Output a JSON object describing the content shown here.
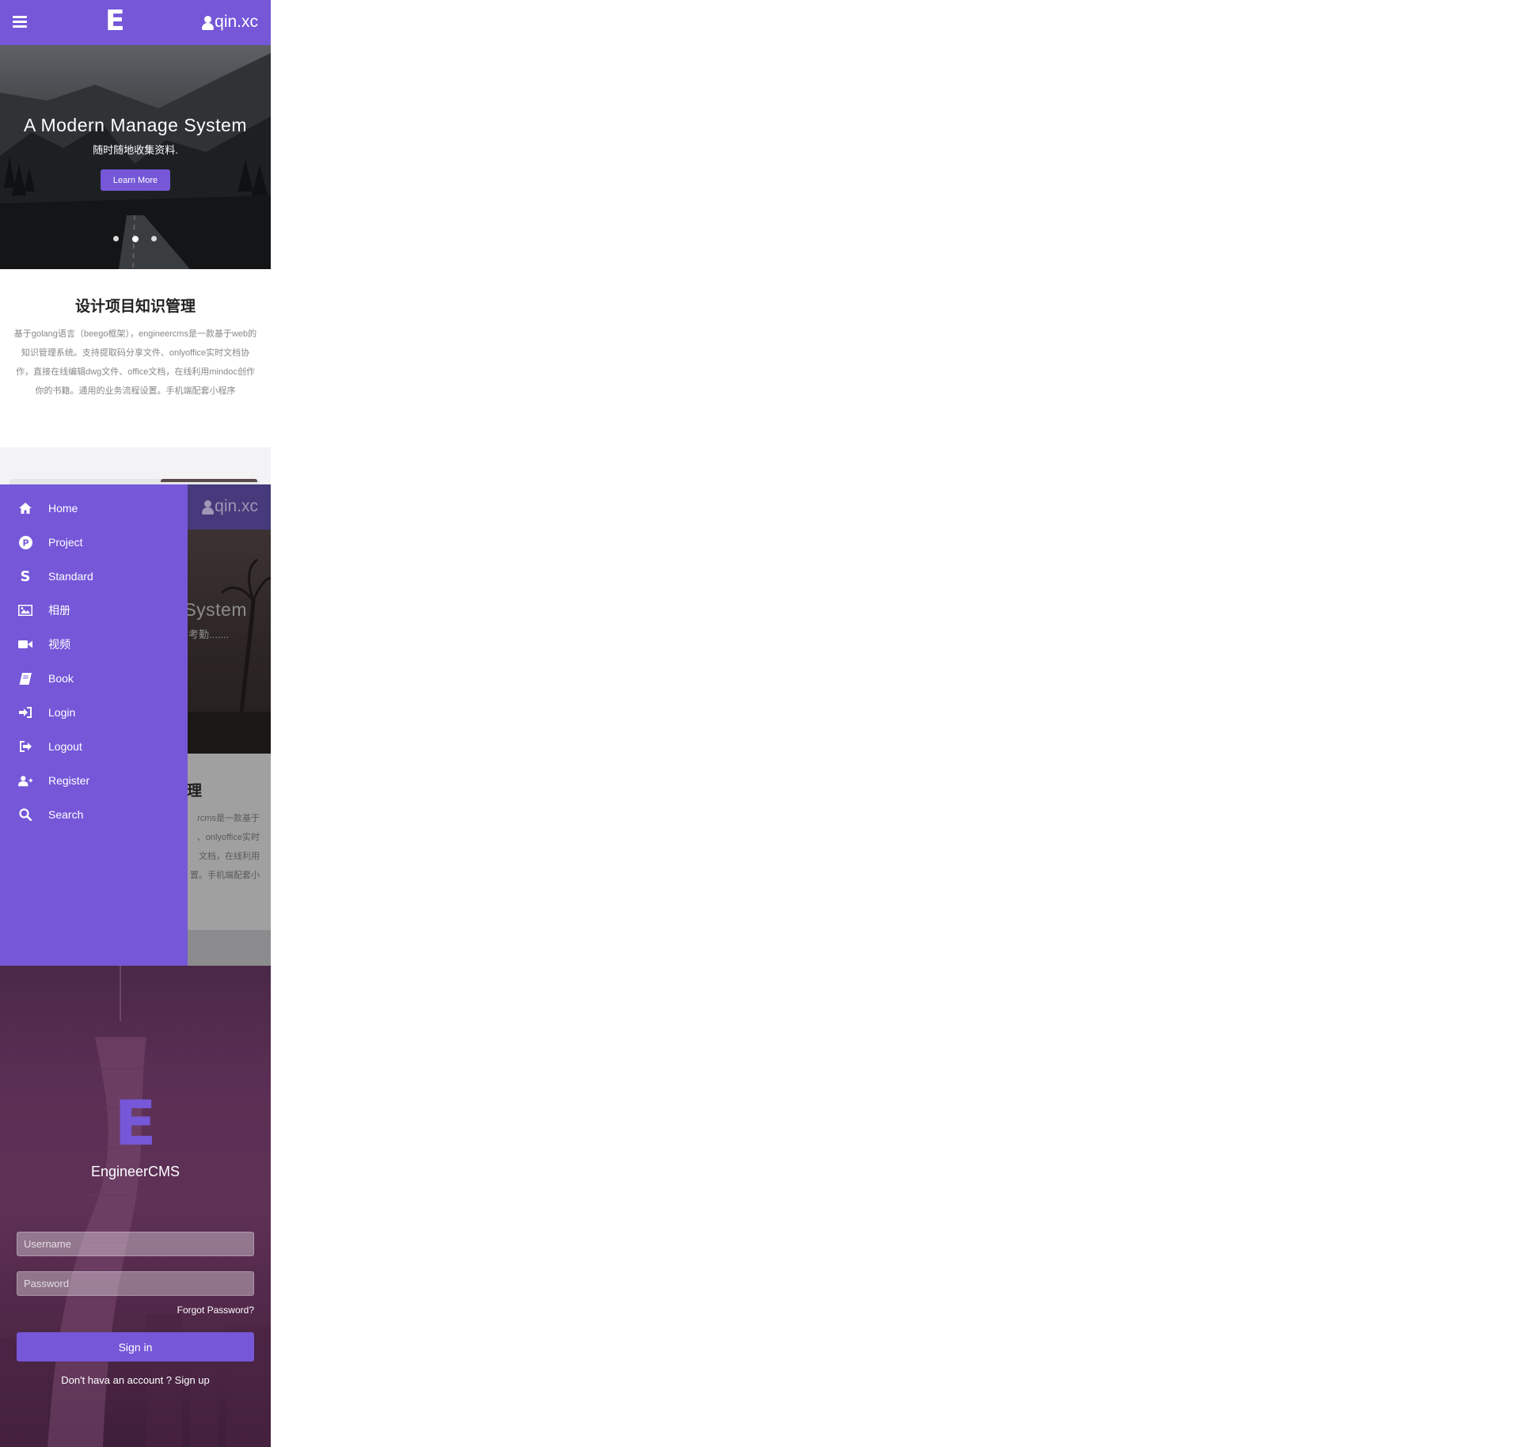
{
  "header": {
    "logo": "E",
    "username": "qin.xc"
  },
  "hero": {
    "title": "A Modern Manage System",
    "subtitle": "随时随地收集资料.",
    "button_label": "Learn More",
    "slides": 3,
    "active_slide": 2
  },
  "intro": {
    "title": "设计项目知识管理",
    "text": "基于golang语言（beego框架），engineercms是一款基于web的知识管理系统。支持提取码分享文件、onlyoffice实时文档协作，直接在线编辑dwg文件、office文档，在线利用mindoc创作你的书籍。通用的业务流程设置。手机端配套小程序"
  },
  "overlay_panel": {
    "username": "qin.xc",
    "hero_title_partial": "System",
    "hero_subtitle_partial": "考勤.......",
    "intro_title_partial": "理",
    "intro_text_partial": "rcms是一款基于 、onlyoffice实时 文档，在线利用 置。手机端配套小"
  },
  "menu": {
    "items": [
      {
        "label": "Home",
        "icon": "home-icon"
      },
      {
        "label": "Project",
        "icon": "project-icon"
      },
      {
        "label": "Standard",
        "icon": "standard-icon"
      },
      {
        "label": "相册",
        "icon": "image-icon"
      },
      {
        "label": "视频",
        "icon": "video-icon"
      },
      {
        "label": "Book",
        "icon": "book-icon"
      },
      {
        "label": "Login",
        "icon": "login-icon"
      },
      {
        "label": "Logout",
        "icon": "logout-icon"
      },
      {
        "label": "Register",
        "icon": "register-icon"
      },
      {
        "label": "Search",
        "icon": "search-icon"
      }
    ]
  },
  "login": {
    "logo": "E",
    "app_name": "EngineerCMS",
    "username_placeholder": "Username",
    "password_placeholder": "Password",
    "forgot_label": "Forgot Password?",
    "signin_label": "Sign in",
    "signup_prompt": "Don't hava an account ? ",
    "signup_link": "Sign up"
  },
  "colors": {
    "accent": "#7557d8",
    "menu_bg": "#7557d8"
  }
}
